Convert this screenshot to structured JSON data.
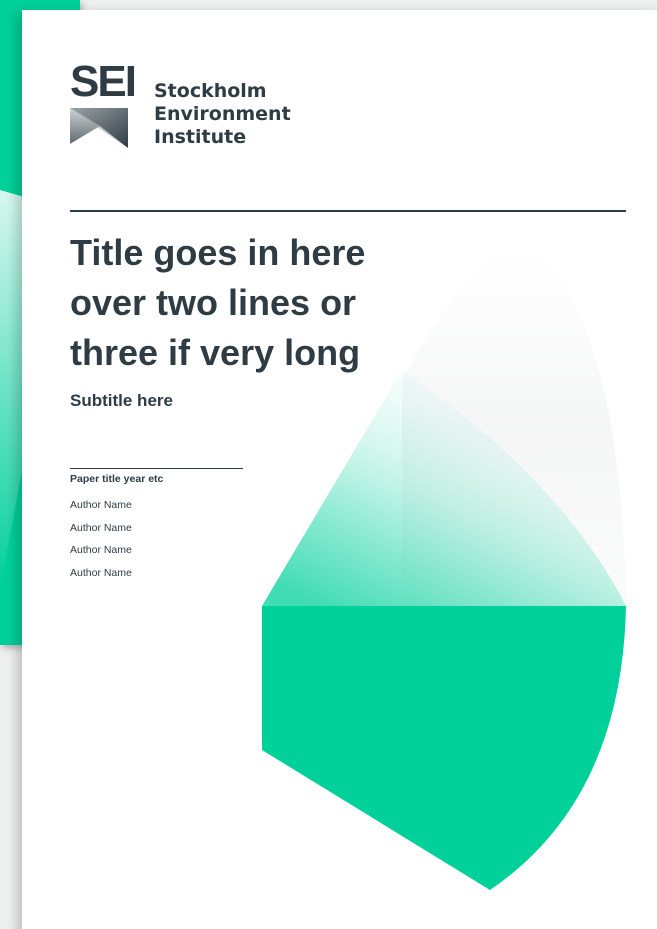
{
  "logo": {
    "abbreviation": "SEI",
    "name_lines": [
      "Stockholm",
      "Environment",
      "Institute"
    ]
  },
  "cover": {
    "title_lines": [
      "Title goes in here",
      "over two lines or",
      "three if very long"
    ],
    "subtitle": "Subtitle here",
    "paper_title": "Paper title year etc",
    "authors": [
      "Author Name",
      "Author Name",
      "Author Name",
      "Author Name"
    ]
  },
  "colors": {
    "brand_green": "#00d09a",
    "text_dark": "#2f3c43"
  }
}
